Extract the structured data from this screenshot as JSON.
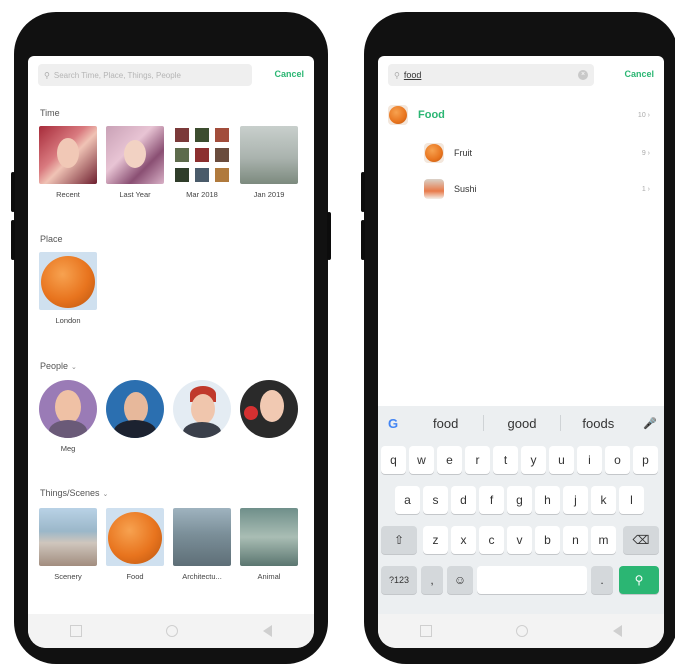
{
  "left": {
    "search_placeholder": "Search Time, Place, Things, People",
    "cancel_label": "Cancel",
    "time": {
      "title": "Time",
      "items": [
        "Recent",
        "Last Year",
        "Mar 2018",
        "Jan 2019"
      ]
    },
    "place": {
      "title": "Place",
      "items": [
        "London"
      ]
    },
    "people": {
      "title": "People",
      "items": [
        "Meg",
        "",
        "",
        ""
      ]
    },
    "things": {
      "title": "Things/Scenes",
      "items": [
        "Scenery",
        "Food",
        "Architectu...",
        "Animal"
      ]
    }
  },
  "right": {
    "search_value": "food",
    "cancel_label": "Cancel",
    "results": [
      {
        "label": "Food",
        "count": "10",
        "level": 0
      },
      {
        "label": "Fruit",
        "count": "9",
        "level": 1
      },
      {
        "label": "Sushi",
        "count": "1",
        "level": 1
      }
    ],
    "keyboard": {
      "suggestions": [
        "food",
        "good",
        "foods"
      ],
      "row1": [
        "q",
        "w",
        "e",
        "r",
        "t",
        "y",
        "u",
        "i",
        "o",
        "p"
      ],
      "row1_hints": [
        "1",
        "2",
        "3",
        "4",
        "5",
        "6",
        "7",
        "8",
        "9",
        "0"
      ],
      "row2": [
        "a",
        "s",
        "d",
        "f",
        "g",
        "h",
        "j",
        "k",
        "l"
      ],
      "row3": [
        "z",
        "x",
        "c",
        "v",
        "b",
        "n",
        "m"
      ],
      "sym_key": "?123",
      "comma": ",",
      "period": "."
    }
  },
  "colors": {
    "accent": "#2bb673",
    "orange": "#e8741e"
  }
}
